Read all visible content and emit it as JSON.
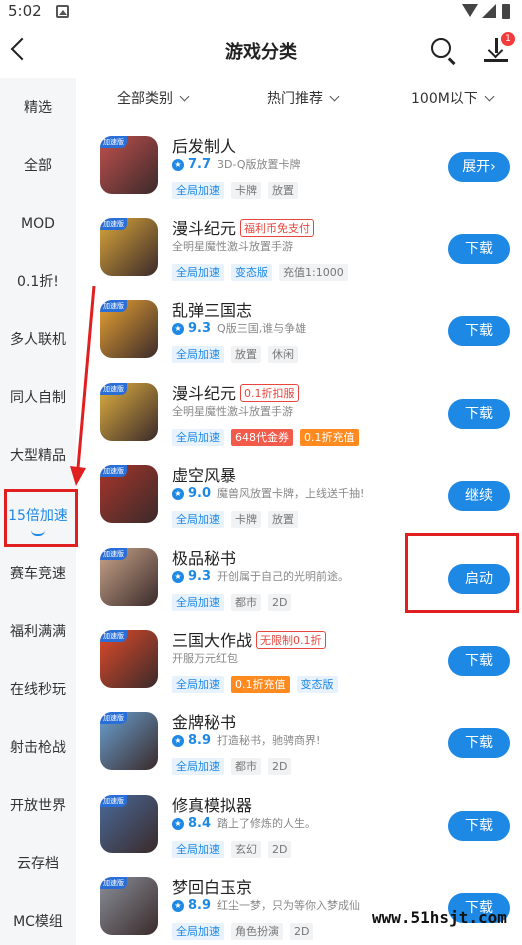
{
  "status_bar": {
    "time": "5:02"
  },
  "header": {
    "title": "游戏分类",
    "download_badge": "1"
  },
  "filters": [
    {
      "label": "全部类别"
    },
    {
      "label": "热门推荐"
    },
    {
      "label": "100M以下"
    }
  ],
  "sidebar": {
    "items": [
      {
        "label": "精选"
      },
      {
        "label": "全部"
      },
      {
        "label": "MOD"
      },
      {
        "label": "0.1折!"
      },
      {
        "label": "多人联机"
      },
      {
        "label": "同人自制"
      },
      {
        "label": "大型精品"
      },
      {
        "label": "15倍加速",
        "active": true
      },
      {
        "label": "赛车竞速"
      },
      {
        "label": "福利满满"
      },
      {
        "label": "在线秒玩"
      },
      {
        "label": "射击枪战"
      },
      {
        "label": "开放世界"
      },
      {
        "label": "云存档"
      },
      {
        "label": "MC模组"
      }
    ]
  },
  "games": [
    {
      "name": "后发制人",
      "name_tag": "",
      "rating": "7.7",
      "desc": "3D-Q版放置卡牌",
      "tags": [
        {
          "text": "全局加速",
          "style": "blue"
        },
        {
          "text": "卡牌",
          "style": "gray"
        },
        {
          "text": "放置",
          "style": "gray"
        }
      ],
      "action": "展开›",
      "icon_color": "#c0504d",
      "speed_label": "加速版"
    },
    {
      "name": "漫斗纪元",
      "name_tag": "福利币免支付",
      "rating": "",
      "desc": "全明星魔性激斗放置手游",
      "tags": [
        {
          "text": "全局加速",
          "style": "blue"
        },
        {
          "text": "变态版",
          "style": "blue"
        },
        {
          "text": "充值1:1000",
          "style": "gray"
        }
      ],
      "action": "下载",
      "icon_color": "#d9a53a",
      "speed_label": "加速版"
    },
    {
      "name": "乱弹三国志",
      "name_tag": "",
      "rating": "9.3",
      "desc": "Q版三国,谁与争雄",
      "tags": [
        {
          "text": "全局加速",
          "style": "blue"
        },
        {
          "text": "放置",
          "style": "gray"
        },
        {
          "text": "休闲",
          "style": "gray"
        }
      ],
      "action": "下载",
      "icon_color": "#e8a233",
      "speed_label": "加速版"
    },
    {
      "name": "漫斗纪元",
      "name_tag": "0.1折扣服",
      "rating": "",
      "desc": "全明星魔性激斗放置手游",
      "tags": [
        {
          "text": "全局加速",
          "style": "blue"
        },
        {
          "text": "648代金券",
          "style": "red"
        },
        {
          "text": "0.1折充值",
          "style": "orange"
        }
      ],
      "action": "下载",
      "icon_color": "#e0b040",
      "speed_label": "加速版"
    },
    {
      "name": "虚空风暴",
      "name_tag": "",
      "rating": "9.0",
      "desc": "魔兽风放置卡牌，上线送千抽!",
      "tags": [
        {
          "text": "全局加速",
          "style": "blue"
        },
        {
          "text": "卡牌",
          "style": "gray"
        },
        {
          "text": "放置",
          "style": "gray"
        }
      ],
      "action": "继续",
      "icon_color": "#a8352a",
      "speed_label": "加速版"
    },
    {
      "name": "极品秘书",
      "name_tag": "",
      "rating": "9.3",
      "desc": "开创属于自己的光明前途。",
      "tags": [
        {
          "text": "全局加速",
          "style": "blue"
        },
        {
          "text": "都市",
          "style": "gray"
        },
        {
          "text": "2D",
          "style": "gray"
        }
      ],
      "action": "启动",
      "icon_color": "#c9a58a",
      "speed_label": "加速版"
    },
    {
      "name": "三国大作战",
      "name_tag": "无限制0.1折",
      "rating": "",
      "desc": "开服万元红包",
      "tags": [
        {
          "text": "全局加速",
          "style": "blue"
        },
        {
          "text": "0.1折充值",
          "style": "orange"
        },
        {
          "text": "变态版",
          "style": "blue"
        }
      ],
      "action": "下载",
      "icon_color": "#e04a2a",
      "speed_label": "加速版"
    },
    {
      "name": "金牌秘书",
      "name_tag": "",
      "rating": "8.9",
      "desc": "打造秘书，驰骋商界!",
      "tags": [
        {
          "text": "全局加速",
          "style": "blue"
        },
        {
          "text": "都市",
          "style": "gray"
        },
        {
          "text": "2D",
          "style": "gray"
        }
      ],
      "action": "下载",
      "icon_color": "#6aa0d0",
      "speed_label": "加速版"
    },
    {
      "name": "修真模拟器",
      "name_tag": "",
      "rating": "8.4",
      "desc": "踏上了修炼的人生。",
      "tags": [
        {
          "text": "全局加速",
          "style": "blue"
        },
        {
          "text": "玄幻",
          "style": "gray"
        },
        {
          "text": "2D",
          "style": "gray"
        }
      ],
      "action": "下载",
      "icon_color": "#4a6a9a",
      "speed_label": "加速版"
    },
    {
      "name": "梦回白玉京",
      "name_tag": "",
      "rating": "8.9",
      "desc": "红尘一梦，只为等你入梦成仙",
      "tags": [
        {
          "text": "全局加速",
          "style": "blue"
        },
        {
          "text": "角色扮演",
          "style": "gray"
        },
        {
          "text": "2D",
          "style": "gray"
        }
      ],
      "action": "下载",
      "icon_color": "#8a8f9a",
      "speed_label": "加速版"
    }
  ],
  "watermark": "www.51hsjt.com",
  "colors": {
    "accent": "#1e88e5",
    "annotation": "#e02020"
  }
}
